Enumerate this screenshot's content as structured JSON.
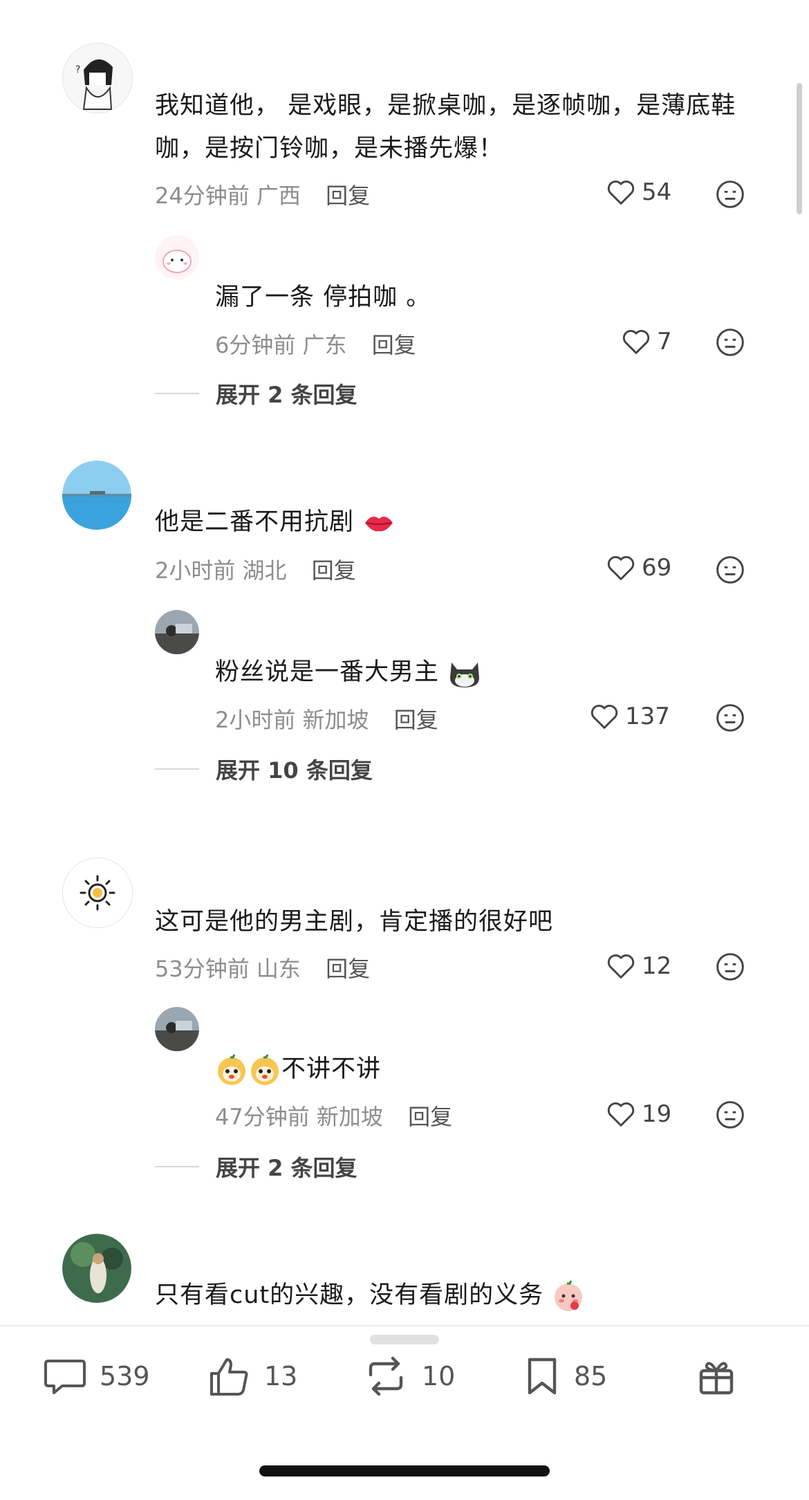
{
  "comments": [
    {
      "text": "我知道他， 是戏眼，是掀桌咖，是逐帧咖，是薄底鞋咖，是按门铃咖，是未播先爆！",
      "time": "24分钟前",
      "location": "广西",
      "reply_label": "回复",
      "likes": "54",
      "replies": [
        {
          "text": "漏了一条 停拍咖 。",
          "time": "6分钟前",
          "location": "广东",
          "reply_label": "回复",
          "likes": "7"
        }
      ],
      "expand_label": "展开 2 条回复"
    },
    {
      "text": "他是二番不用抗剧",
      "time": "2小时前",
      "location": "湖北",
      "reply_label": "回复",
      "likes": "69",
      "replies": [
        {
          "text": "粉丝说是一番大男主",
          "time": "2小时前",
          "location": "新加坡",
          "reply_label": "回复",
          "likes": "137"
        }
      ],
      "expand_label": "展开 10 条回复"
    },
    {
      "text": "这可是他的男主剧，肯定播的很好吧",
      "time": "53分钟前",
      "location": "山东",
      "reply_label": "回复",
      "likes": "12",
      "replies": [
        {
          "text": "不讲不讲",
          "time": "47分钟前",
          "location": "新加坡",
          "reply_label": "回复",
          "likes": "19"
        }
      ],
      "expand_label": "展开 2 条回复"
    },
    {
      "text": "只有看cut的兴趣，没有看剧的义务"
    }
  ],
  "bottom_bar": {
    "comments_count": "539",
    "likes_count": "13",
    "reposts_count": "10",
    "favorites_count": "85"
  },
  "icons": {
    "like": "heart-outline-icon",
    "dislike": "neutral-face-icon",
    "comment": "speech-bubble-icon",
    "thumb": "thumbs-up-icon",
    "repost": "repost-icon",
    "favorite": "bookmark-icon",
    "gift": "gift-icon"
  }
}
